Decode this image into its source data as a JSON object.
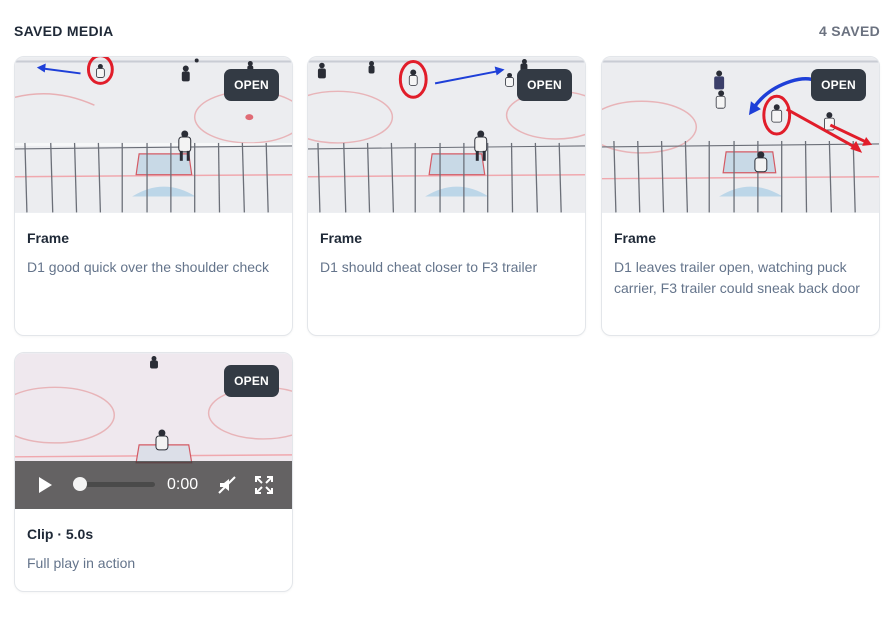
{
  "header": {
    "title": "SAVED MEDIA",
    "count": "4 SAVED"
  },
  "cards": [
    {
      "open_label": "OPEN",
      "title": "Frame",
      "description": "D1 good quick over the shoulder check"
    },
    {
      "open_label": "OPEN",
      "title": "Frame",
      "description": "D1 should cheat closer to F3 trailer"
    },
    {
      "open_label": "OPEN",
      "title": "Frame",
      "description": "D1 leaves trailer open, watching puck carrier, F3 trailer could sneak back door"
    },
    {
      "open_label": "OPEN",
      "title": "Clip · 5.0s",
      "description": "Full play in action",
      "player": {
        "time": "0:00",
        "progress": 0
      }
    }
  ],
  "colors": {
    "annotation_red": "#e11d2a",
    "annotation_blue": "#1e3fd8",
    "open_button": "#333a44"
  },
  "icons": [
    "play-icon",
    "mute-icon",
    "fullscreen-icon"
  ]
}
